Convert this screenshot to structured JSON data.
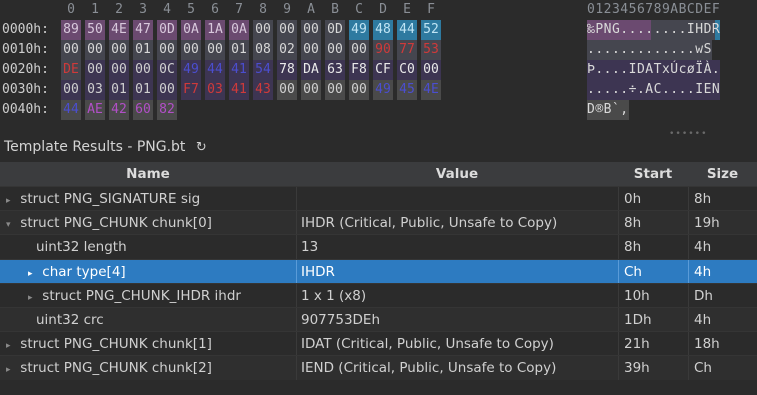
{
  "hex": {
    "header": {
      "columns": [
        "0",
        "1",
        "2",
        "3",
        "4",
        "5",
        "6",
        "7",
        "8",
        "9",
        "A",
        "B",
        "C",
        "D",
        "E",
        "F"
      ],
      "ascii": "0123456789ABCDEF"
    },
    "rows": [
      {
        "addr": "0000h:",
        "bytes": [
          "89",
          "50",
          "4E",
          "47",
          "0D",
          "0A",
          "1A",
          "0A",
          "00",
          "00",
          "00",
          "0D",
          "49",
          "48",
          "44",
          "52"
        ],
        "ascii": "‰PNG........IHDR"
      },
      {
        "addr": "0010h:",
        "bytes": [
          "00",
          "00",
          "00",
          "01",
          "00",
          "00",
          "00",
          "01",
          "08",
          "02",
          "00",
          "00",
          "00",
          "90",
          "77",
          "53"
        ],
        "ascii": ".............wS"
      },
      {
        "addr": "0020h:",
        "bytes": [
          "DE",
          "00",
          "00",
          "00",
          "0C",
          "49",
          "44",
          "41",
          "54",
          "78",
          "DA",
          "63",
          "F8",
          "CF",
          "C0",
          "00"
        ],
        "ascii": "Þ....IDATxÚcøÏÀ."
      },
      {
        "addr": "0030h:",
        "bytes": [
          "00",
          "03",
          "01",
          "01",
          "00",
          "F7",
          "03",
          "41",
          "43",
          "00",
          "00",
          "00",
          "00",
          "49",
          "45",
          "4E"
        ],
        "ascii": ".....÷.AC....IEN"
      },
      {
        "addr": "0040h:",
        "bytes": [
          "44",
          "AE",
          "42",
          "60",
          "82"
        ],
        "ascii": "D®B`‚"
      }
    ]
  },
  "template": {
    "title": "Template Results - PNG.bt",
    "columns": {
      "name": "Name",
      "value": "Value",
      "start": "Start",
      "size": "Size"
    },
    "rows": [
      {
        "name": "struct PNG_SIGNATURE sig",
        "value": "",
        "start": "0h",
        "size": "8h"
      },
      {
        "name": "struct PNG_CHUNK chunk[0]",
        "value": "IHDR  (Critical, Public, Unsafe to Copy)",
        "start": "8h",
        "size": "19h"
      },
      {
        "name": "uint32 length",
        "value": "13",
        "start": "8h",
        "size": "4h"
      },
      {
        "name": "char type[4]",
        "value": "IHDR",
        "start": "Ch",
        "size": "4h"
      },
      {
        "name": "struct PNG_CHUNK_IHDR ihdr",
        "value": "1 x 1 (x8)",
        "start": "10h",
        "size": "Dh"
      },
      {
        "name": "uint32 crc",
        "value": "907753DEh",
        "start": "1Dh",
        "size": "4h"
      },
      {
        "name": "struct PNG_CHUNK chunk[1]",
        "value": "IDAT  (Critical, Public, Unsafe to Copy)",
        "start": "21h",
        "size": "18h"
      },
      {
        "name": "struct PNG_CHUNK chunk[2]",
        "value": "IEND  (Critical, Public, Unsafe to Copy)",
        "start": "39h",
        "size": "Ch"
      }
    ]
  },
  "icons": {
    "refresh": "refresh-icon",
    "expand": "expand-triangle-icon",
    "collapse": "collapse-triangle-icon"
  },
  "colors": {
    "selection": "#2d7bc1",
    "ihdr_highlight": "#2e7aa0",
    "signature_highlight": "#6b4a70"
  }
}
